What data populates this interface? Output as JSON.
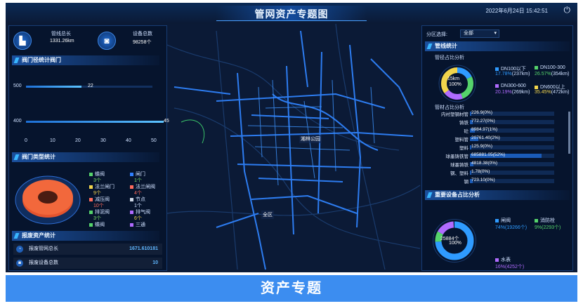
{
  "header": {
    "title": "管网资产专题图",
    "datetime": "2022年6月24日 15:42:51"
  },
  "left": {
    "pipe_total_label": "管线总长",
    "pipe_total_value": "1331.26km",
    "device_total_label": "设备总数",
    "device_total_value": "98258个",
    "valve_diameter_title": "阀门径统计阀门",
    "diameter_rows": [
      {
        "tick": "500",
        "value": "22"
      },
      {
        "tick": "400",
        "value": "45"
      }
    ],
    "x_ticks": [
      "0",
      "10",
      "20",
      "30",
      "40",
      "50"
    ],
    "valve_type_title": "阀门类型统计",
    "valve_types": [
      {
        "name": "蝶阀",
        "count": "3个",
        "color": "#55d36b"
      },
      {
        "name": "闸门",
        "count": "1个",
        "color": "#2f7fff"
      },
      {
        "name": "法兰闸门",
        "count": "9个",
        "color": "#f2d54c"
      },
      {
        "name": "法兰闸阀",
        "count": "4个",
        "color": "#ff6b5c"
      },
      {
        "name": "减压阀",
        "count": "10个",
        "color": "#ff6b5c"
      },
      {
        "name": "节点",
        "count": "1个",
        "color": "#cfd8e6"
      },
      {
        "name": "排泥阀",
        "count": "3个",
        "color": "#55d36b"
      },
      {
        "name": "排气阀",
        "count": "6个",
        "color": "#b06bff"
      },
      {
        "name": "蝶阀",
        "count": "",
        "color": "#55d36b"
      },
      {
        "name": "三通",
        "count": "",
        "color": "#b06bff"
      }
    ],
    "scrap_title": "报废资产统计",
    "scrap_rows": [
      {
        "label": "报废管网总长",
        "value": "1671.610181"
      },
      {
        "label": "报废设备总数",
        "value": "10"
      }
    ]
  },
  "map": {
    "labels": [
      "湘林公园",
      "全区"
    ]
  },
  "right": {
    "district_label": "分区选择:",
    "district_value": "全部",
    "pipe_stats_title": "管线统计",
    "diameter_title": "管径占比分析",
    "ring_center_top": "15km",
    "ring_center_bottom": "100%",
    "diameter_legend": [
      {
        "name": "DN100以下",
        "pct": "17.78%",
        "len": "(237km)",
        "color": "#2f9bff"
      },
      {
        "name": "DN100-300",
        "pct": "26.57%",
        "len": "(354km)",
        "color": "#55d36b"
      },
      {
        "name": "DN300-600",
        "pct": "20.19%",
        "len": "(269km)",
        "color": "#b06bff"
      },
      {
        "name": "DN600以上",
        "pct": "35.45%",
        "len": "(472km)",
        "color": "#f2d54c"
      }
    ],
    "material_title": "管材占比分析",
    "materials": [
      {
        "name": "内衬塑钢材管",
        "val": "226.9(0%)",
        "fill": 0.02
      },
      {
        "name": "铸铁",
        "val": "772.27(0%)",
        "fill": 0.03
      },
      {
        "name": "砼",
        "val": "8984.97(1%)",
        "fill": 0.06
      },
      {
        "name": "塑料管",
        "val": "20761.40(2%)",
        "fill": 0.1
      },
      {
        "name": "塑料",
        "val": "125.9(0%)",
        "fill": 0.02
      },
      {
        "name": "球墨铸铁管",
        "val": "685881.05(52%)",
        "fill": 0.85
      },
      {
        "name": "球墨铸铁",
        "val": "4818.38(0%)",
        "fill": 0.04
      },
      {
        "name": "钢、塑料",
        "val": "1.78(0%)",
        "fill": 0.01
      },
      {
        "name": "钢",
        "val": "723.10(0%)",
        "fill": 0.03
      }
    ],
    "key_device_title": "重要设备占比分析",
    "device_center_top": "25884个",
    "device_center_bottom": "100%",
    "device_legend": [
      {
        "name": "闸阀",
        "text": "74%(19266个)",
        "color": "#2f9bff"
      },
      {
        "name": "消防栓",
        "text": "9%(2293个)",
        "color": "#55d36b"
      },
      {
        "name": "水表",
        "text": "16%(4252个)",
        "color": "#b06bff"
      }
    ]
  },
  "footer": {
    "banner": "资产专题"
  },
  "colors": {
    "background": "#0a1730",
    "accent": "#39b6ff",
    "banner": "#3c8df0",
    "road": "#2d7cf0"
  }
}
